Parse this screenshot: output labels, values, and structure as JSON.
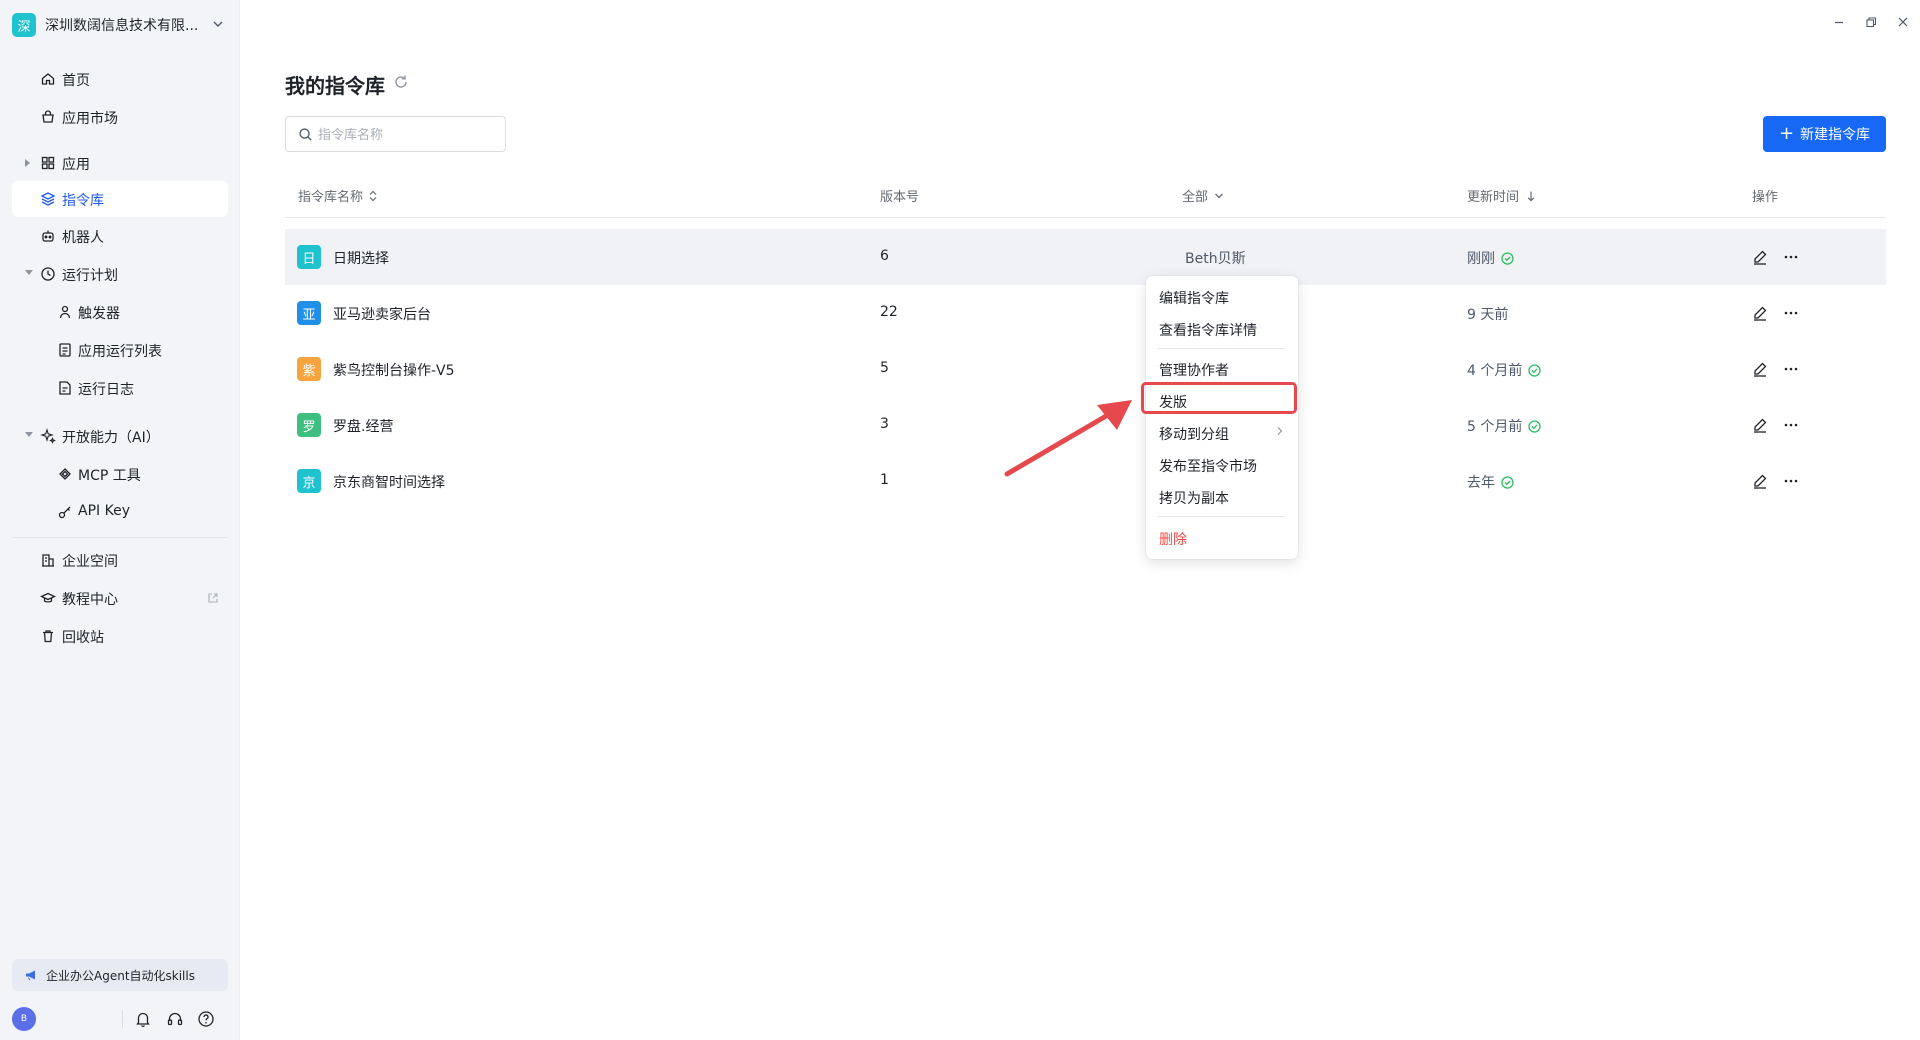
{
  "sidebar": {
    "org_logo_char": "深",
    "org_name": "深圳数阔信息技术有限...",
    "nav": {
      "home": "首页",
      "market": "应用市场",
      "apps": "应用",
      "library": "指令库",
      "robots": "机器人",
      "schedules": "运行计划",
      "triggers": "触发器",
      "run_list": "应用运行列表",
      "run_logs": "运行日志",
      "open_ai": "开放能力（AI）",
      "mcp": "MCP 工具",
      "api_key": "API Key",
      "enterprise": "企业空间",
      "tutorial": "教程中心",
      "trash": "回收站"
    },
    "promo": "企业办公Agent自动化skills",
    "avatar_char": "B"
  },
  "main": {
    "title": "我的指令库",
    "search_placeholder": "指令库名称",
    "new_button": "新建指令库",
    "columns": {
      "name": "指令库名称",
      "version": "版本号",
      "owner_filter": "全部",
      "updated": "更新时间",
      "actions": "操作"
    },
    "rows": [
      {
        "icon": "日",
        "name": "日期选择",
        "version": "6",
        "owner": "Beth贝斯",
        "updated": "刚刚",
        "published": true
      },
      {
        "icon": "亚",
        "name": "亚马逊卖家后台",
        "version": "22",
        "owner": "",
        "updated": "9 天前",
        "published": false
      },
      {
        "icon": "紫",
        "name": "紫鸟控制台操作-V5",
        "version": "5",
        "owner": "",
        "updated": "4 个月前",
        "published": true
      },
      {
        "icon": "罗",
        "name": "罗盘.经营",
        "version": "3",
        "owner": "",
        "updated": "5 个月前",
        "published": true
      },
      {
        "icon": "京",
        "name": "京东商智时间选择",
        "version": "1",
        "owner": "",
        "updated": "去年",
        "published": true
      }
    ]
  },
  "context_menu": {
    "edit": "编辑指令库",
    "details": "查看指令库详情",
    "collaborators": "管理协作者",
    "publish": "发版",
    "move_group": "移动到分组",
    "publish_market": "发布至指令市场",
    "copy": "拷贝为副本",
    "delete": "删除"
  },
  "colors": {
    "accent": "#1668f5",
    "badge_colors": [
      "#1fc3cf",
      "#1f8fe8",
      "#f7a33e",
      "#3fbf7f",
      "#1fc3cf"
    ],
    "highlight": "#e5484d",
    "success": "#2fbd63"
  }
}
